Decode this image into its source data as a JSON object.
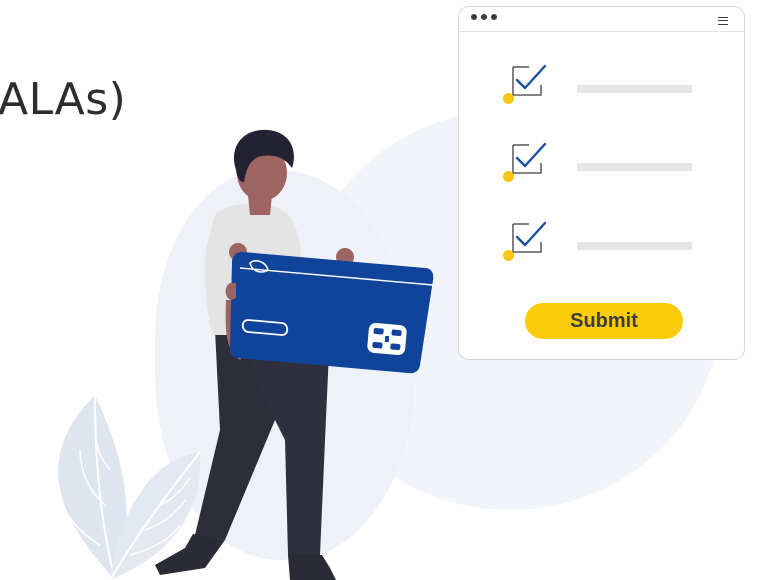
{
  "header": {
    "title": "ALAs)"
  },
  "form_window": {
    "window_dots": [
      "dot",
      "dot",
      "dot"
    ],
    "menu_icon": "hamburger-menu-icon",
    "checklist": [
      {
        "checked": true,
        "icon": "checkmark-icon"
      },
      {
        "checked": true,
        "icon": "checkmark-icon"
      },
      {
        "checked": true,
        "icon": "checkmark-icon"
      }
    ],
    "submit_label": "Submit"
  },
  "colors": {
    "accent_yellow": "#fccc0a",
    "card_blue": "#10449b",
    "check_blue": "#1c4fa0",
    "background_blob": "#f1f4f9"
  }
}
